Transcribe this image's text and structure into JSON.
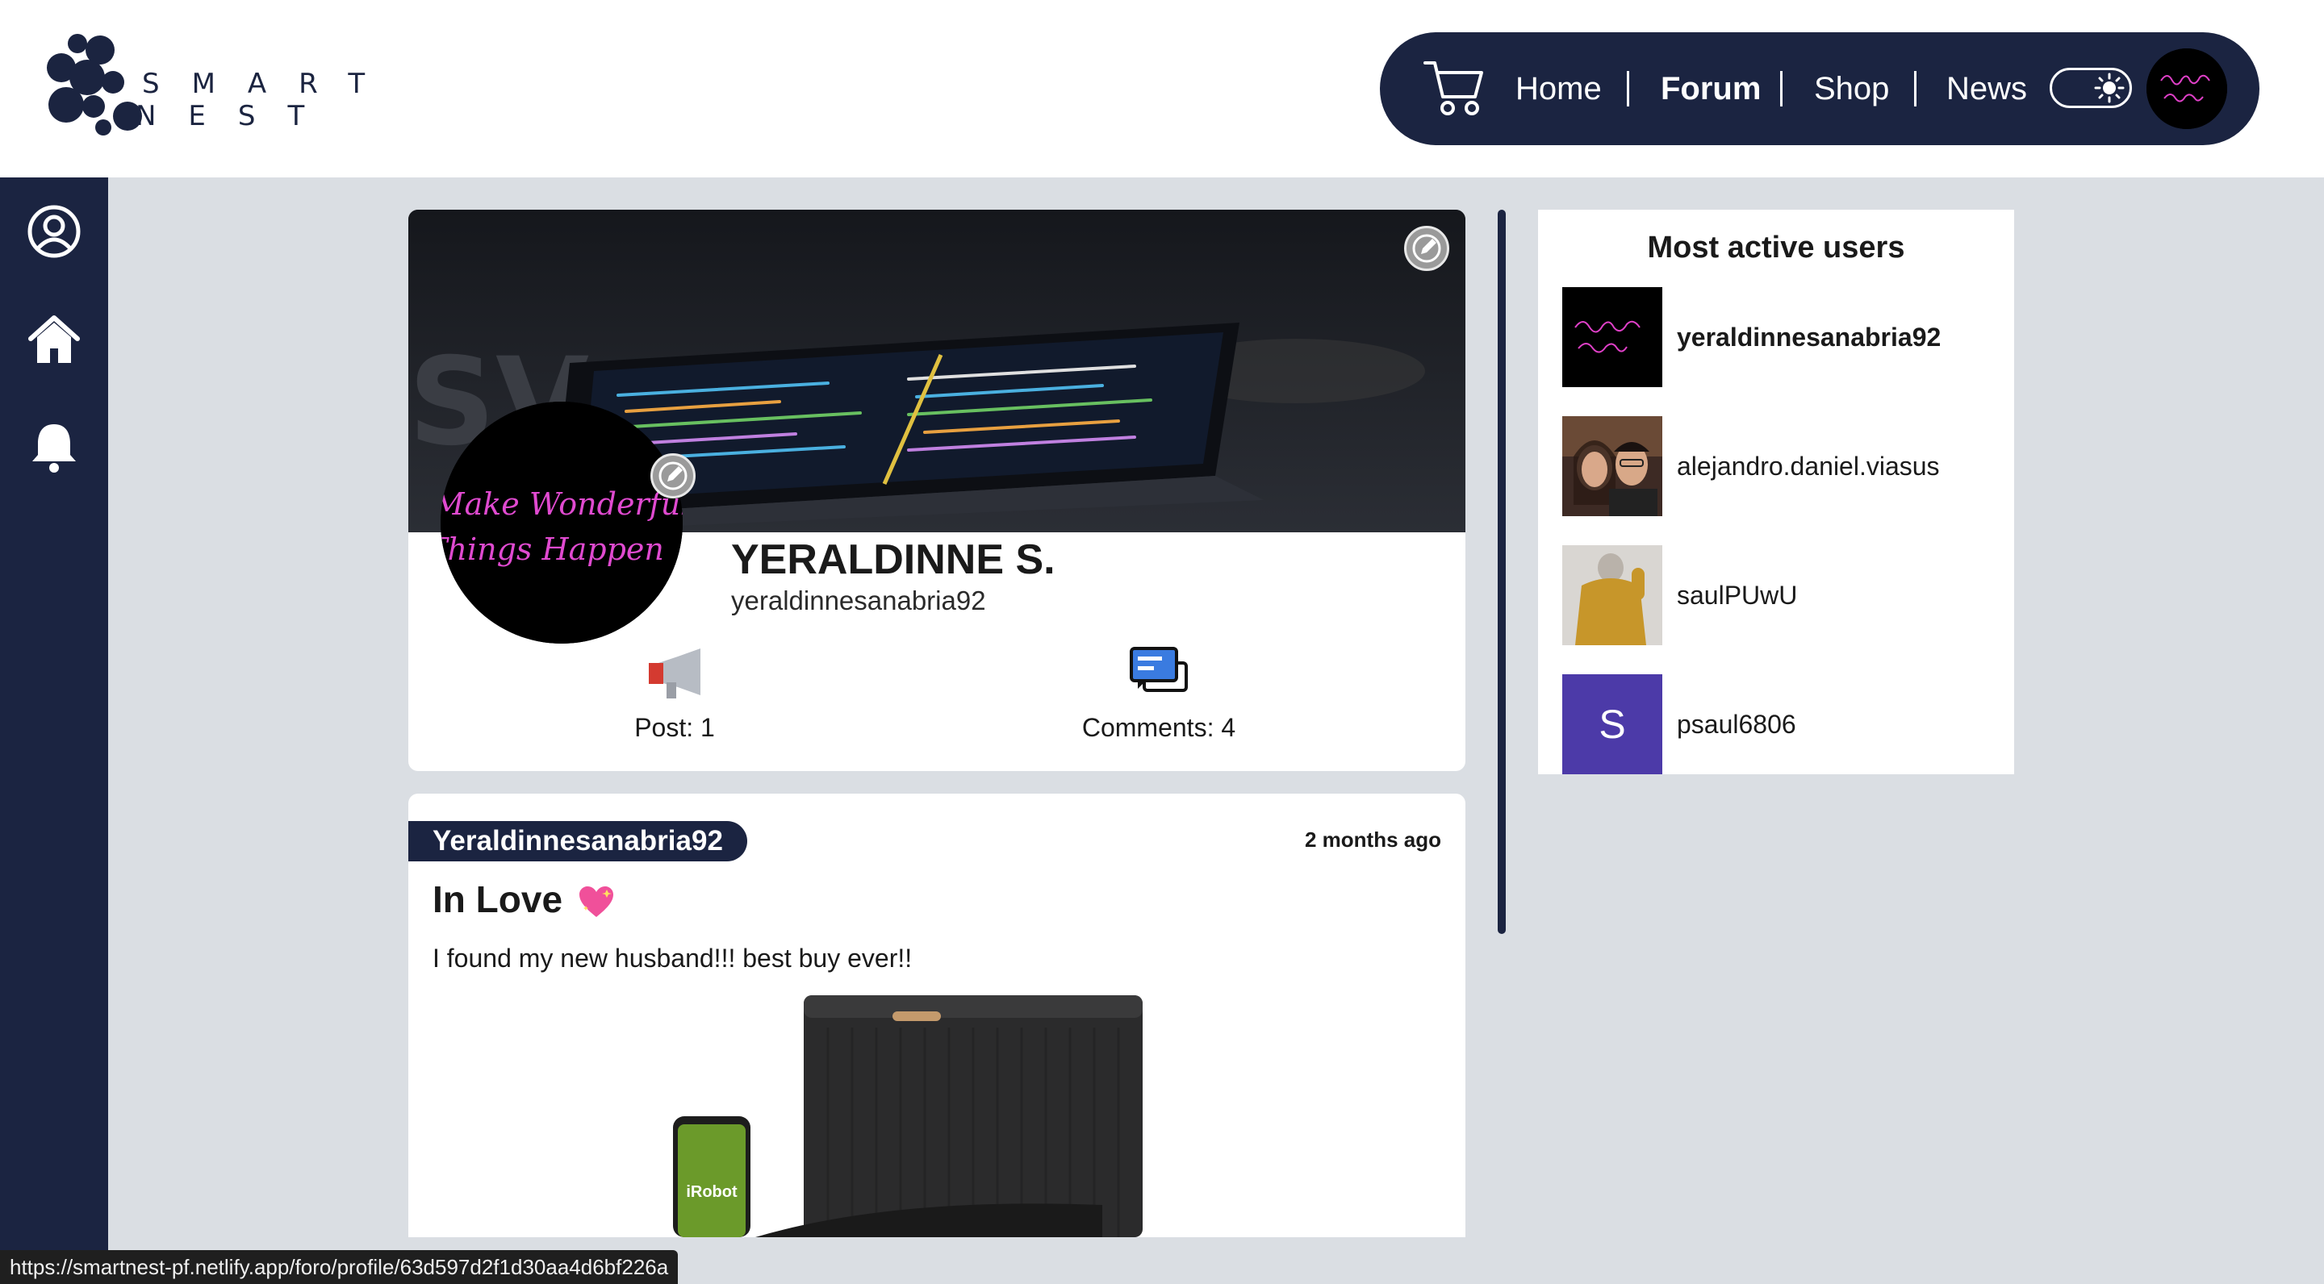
{
  "brand": {
    "logo_text_top": "SMART",
    "logo_text_bottom": "NEST",
    "navy": "#1b2441"
  },
  "nav": {
    "home": "Home",
    "forum": "Forum",
    "shop": "Shop",
    "news": "News",
    "active": "Forum",
    "cart_icon": "cart-icon",
    "theme_toggle_icon": "sun-icon"
  },
  "sidebar": {
    "items": [
      {
        "icon": "user-circle-icon"
      },
      {
        "icon": "home-icon"
      },
      {
        "icon": "bell-icon"
      }
    ]
  },
  "profile": {
    "name": "YERALDINNE S.",
    "handle": "yeraldinnesanabria92",
    "avatar_text_line1": "Make Wonderful",
    "avatar_text_line2": "Things Happen",
    "stats": {
      "posts_label": "Post: 1",
      "comments_label": "Comments: 4"
    }
  },
  "post": {
    "author": "Yeraldinnesanabria92",
    "time": "2 months ago",
    "title": "In Love",
    "body": "I found my new husband!!! best buy ever!!",
    "image_brand_text": "iRobot"
  },
  "active_users": {
    "title": "Most active users",
    "users": [
      {
        "name": "yeraldinnesanabria92",
        "bold": true
      },
      {
        "name": "alejandro.daniel.viasus",
        "bold": false
      },
      {
        "name": "saulPUwU",
        "bold": false
      },
      {
        "name": "psaul6806",
        "bold": false,
        "initial": "S"
      }
    ]
  },
  "status_url": "https://smartnest-pf.netlify.app/foro/profile/63d597d2f1d30aa4d6bf226a"
}
